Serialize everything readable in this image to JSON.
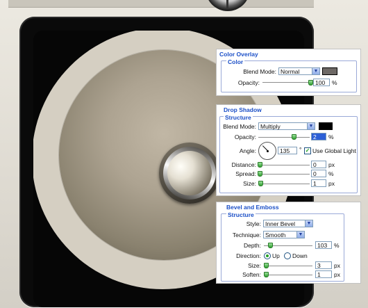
{
  "colors": {
    "overlay_swatch": "#6d6865",
    "shadow_swatch": "#000000",
    "disc_light": "#d5cfc2",
    "disc_dark": "#5e584a",
    "group_title": "#1b4fc7"
  },
  "color_overlay": {
    "title": "Color Overlay",
    "group": "Color",
    "blend_mode_label": "Blend Mode:",
    "blend_mode_value": "Normal",
    "opacity_label": "Opacity:",
    "opacity_value": "100",
    "opacity_percent": 1.0,
    "unit": "%"
  },
  "drop_shadow": {
    "title": "Drop Shadow",
    "group": "Structure",
    "blend_mode_label": "Blend Mode:",
    "blend_mode_value": "Multiply",
    "opacity_label": "Opacity:",
    "opacity_value": "2",
    "opacity_unit": "%",
    "angle_label": "Angle:",
    "angle_value": "135",
    "angle_unit": "°",
    "global_light_label": "Use Global Light",
    "global_light_checked": true,
    "distance_label": "Distance:",
    "distance_value": "0",
    "distance_unit": "px",
    "spread_label": "Spread:",
    "spread_value": "0",
    "spread_unit": "%",
    "size_label": "Size:",
    "size_value": "1",
    "size_unit": "px"
  },
  "bevel_emboss": {
    "title": "Bevel and Emboss",
    "group": "Structure",
    "style_label": "Style:",
    "style_value": "Inner Bevel",
    "technique_label": "Technique:",
    "technique_value": "Smooth",
    "depth_label": "Depth:",
    "depth_value": "103",
    "depth_unit": "%",
    "direction_label": "Direction:",
    "direction_up": "Up",
    "direction_down": "Down",
    "direction_selected": "Up",
    "size_label": "Size:",
    "size_value": "3",
    "size_unit": "px",
    "soften_label": "Soften:",
    "soften_value": "1",
    "soften_unit": "px"
  },
  "icons": {
    "dropdown": "chevron-down-icon",
    "checkmark": "check-icon"
  }
}
